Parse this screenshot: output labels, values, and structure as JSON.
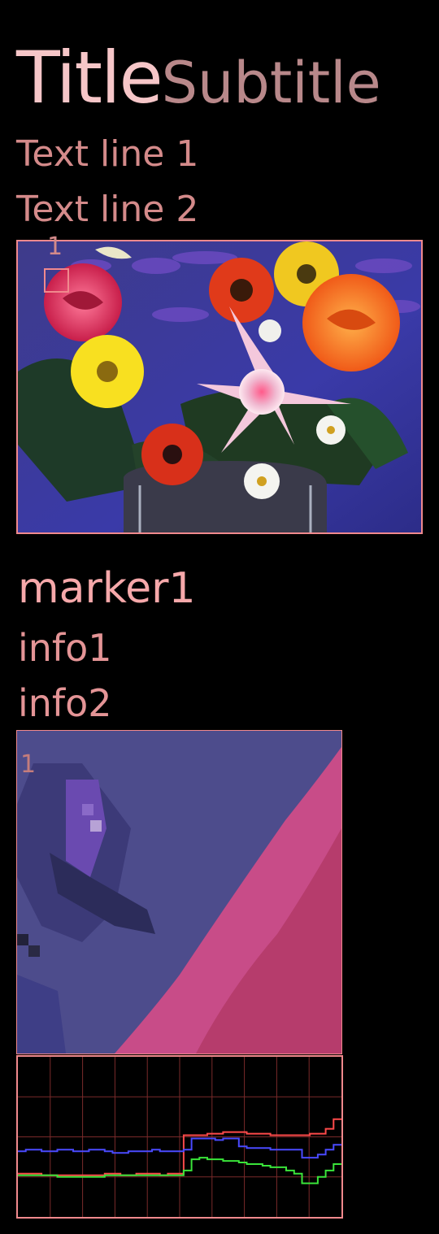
{
  "header": {
    "title": "Title",
    "subtitle": "Subtitle"
  },
  "text_lines": [
    "Text line 1",
    "Text line 2"
  ],
  "marker": {
    "number": "1",
    "label": "marker1",
    "info": [
      "info1",
      "info2"
    ]
  },
  "zoom": {
    "number": "1"
  },
  "colors": {
    "accent": "#f0898d",
    "title": "#f6c6c8",
    "subtitle": "#b8888a",
    "text": "#d48a8a",
    "series_red": "#ff4a4a",
    "series_blue": "#4a4aff",
    "series_green": "#3ae43a",
    "grid": "#7a2a2a"
  },
  "chart_data": {
    "type": "line",
    "grid": true,
    "series": [
      {
        "color": "red",
        "values": [
          0.27,
          0.27,
          0.27,
          0.26,
          0.26,
          0.26,
          0.26,
          0.26,
          0.26,
          0.26,
          0.26,
          0.27,
          0.27,
          0.26,
          0.26,
          0.27,
          0.27,
          0.27,
          0.26,
          0.27,
          0.27,
          0.51,
          0.51,
          0.51,
          0.52,
          0.52,
          0.53,
          0.53,
          0.53,
          0.52,
          0.52,
          0.52,
          0.51,
          0.51,
          0.51,
          0.51,
          0.51,
          0.52,
          0.52,
          0.55,
          0.61
        ]
      },
      {
        "color": "blue",
        "values": [
          0.41,
          0.42,
          0.42,
          0.41,
          0.41,
          0.42,
          0.42,
          0.41,
          0.41,
          0.42,
          0.42,
          0.41,
          0.4,
          0.4,
          0.41,
          0.41,
          0.41,
          0.42,
          0.41,
          0.41,
          0.41,
          0.42,
          0.49,
          0.49,
          0.49,
          0.48,
          0.49,
          0.49,
          0.44,
          0.43,
          0.43,
          0.43,
          0.42,
          0.42,
          0.42,
          0.42,
          0.37,
          0.37,
          0.39,
          0.42,
          0.45
        ]
      },
      {
        "color": "green",
        "values": [
          0.26,
          0.26,
          0.26,
          0.26,
          0.26,
          0.25,
          0.25,
          0.25,
          0.25,
          0.25,
          0.25,
          0.26,
          0.26,
          0.26,
          0.26,
          0.26,
          0.26,
          0.26,
          0.26,
          0.26,
          0.26,
          0.29,
          0.36,
          0.37,
          0.36,
          0.36,
          0.35,
          0.35,
          0.34,
          0.33,
          0.33,
          0.32,
          0.31,
          0.31,
          0.29,
          0.27,
          0.21,
          0.21,
          0.25,
          0.29,
          0.33
        ]
      }
    ]
  }
}
